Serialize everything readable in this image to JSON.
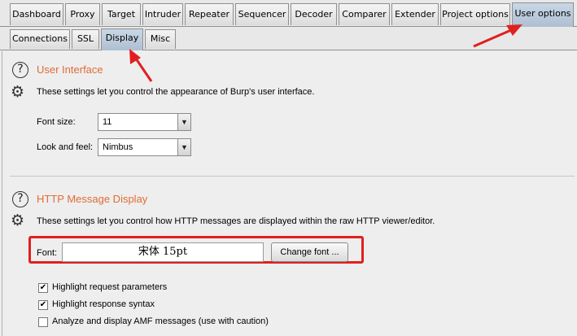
{
  "main_tabs": [
    "Dashboard",
    "Proxy",
    "Target",
    "Intruder",
    "Repeater",
    "Sequencer",
    "Decoder",
    "Comparer",
    "Extender",
    "Project options",
    "User options"
  ],
  "sub_tabs": [
    "Connections",
    "SSL",
    "Display",
    "Misc"
  ],
  "ui_section": {
    "title": "User Interface",
    "description": "These settings let you control the appearance of Burp's user interface.",
    "font_size_label": "Font size:",
    "font_size_value": "11",
    "look_label": "Look and feel:",
    "look_value": "Nimbus"
  },
  "http_section": {
    "title": "HTTP Message Display",
    "description": "These settings let you control how HTTP messages are displayed within the raw HTTP viewer/editor.",
    "font_label": "Font:",
    "font_value": "宋体 15pt",
    "change_font_label": "Change font ...",
    "checkboxes": [
      {
        "label": "Highlight request parameters",
        "checked": true
      },
      {
        "label": "Highlight response syntax",
        "checked": true
      },
      {
        "label": "Analyze and display AMF messages (use with caution)",
        "checked": false
      }
    ]
  },
  "icons": {
    "help": "help-circle-icon",
    "settings": "gear-icon",
    "dropdown": "chevron-down-icon",
    "check": "checkmark-icon"
  },
  "colors": {
    "section_title": "#e06c35",
    "active_tab": "#b8c9dc",
    "annotation": "#e02020"
  }
}
